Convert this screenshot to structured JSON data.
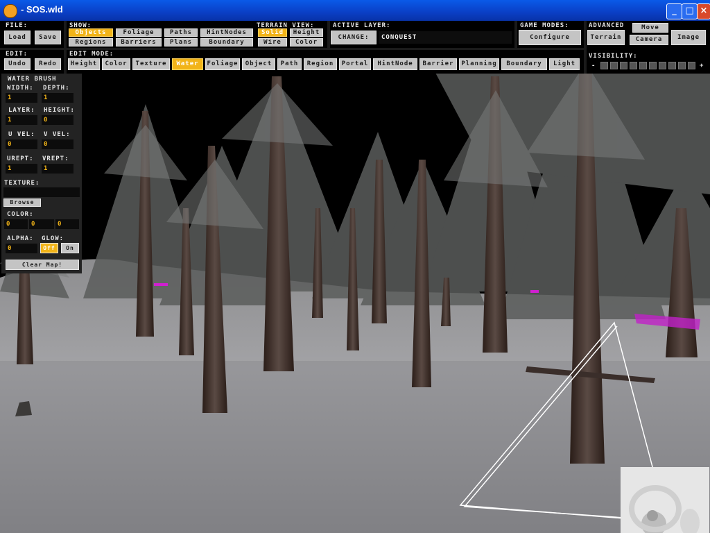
{
  "window": {
    "title": "- SOS.wld"
  },
  "file": {
    "label": "FILE:",
    "load": "Load",
    "save": "Save"
  },
  "show": {
    "label": "SHOW:",
    "row1": [
      "Objects",
      "Foliage",
      "Paths",
      "HintNodes"
    ],
    "row2": [
      "Regions",
      "Barriers",
      "Plans",
      "Boundary"
    ],
    "selected": "Objects"
  },
  "terrain_view": {
    "label": "TERRAIN VIEW:",
    "row1": [
      "Solid",
      "Height"
    ],
    "row2": [
      "Wire",
      "Color"
    ],
    "selected": "Solid"
  },
  "active_layer": {
    "label": "ACTIVE LAYER:",
    "change": "CHANGE:",
    "value": "CONQUEST"
  },
  "game_modes": {
    "label": "GAME MODES:",
    "configure": "Configure"
  },
  "advanced": {
    "label": "ADVANCED",
    "terrain": "Terrain",
    "move": "Move",
    "camera": "Camera",
    "image": "Image"
  },
  "edit": {
    "label": "EDIT:",
    "undo": "Undo",
    "redo": "Redo"
  },
  "edit_mode": {
    "label": "EDIT MODE:",
    "items": [
      "Height",
      "Color",
      "Texture",
      "Water",
      "Foliage",
      "Object",
      "Path",
      "Region",
      "Portal",
      "HintNode",
      "Barrier",
      "Planning",
      "Boundary",
      "Light"
    ],
    "selected": "Water"
  },
  "visibility": {
    "label": "VISIBILITY:",
    "minus": "-",
    "plus": "+",
    "boxes": 10
  },
  "brush": {
    "title": "WATER BRUSH",
    "width_label": "WIDTH:",
    "width": "1",
    "depth_label": "DEPTH:",
    "depth": "1",
    "layer_label": "LAYER:",
    "layer": "1",
    "height_label": "HEIGHT:",
    "height": "0",
    "uvel_label": "U VEL:",
    "uvel": "0",
    "vvel_label": "V VEL:",
    "vvel": "0",
    "urept_label": "UREPT:",
    "urept": "1",
    "vrept_label": "VREPT:",
    "vrept": "1",
    "texture_label": "TEXTURE:",
    "texture": "",
    "browse": "Browse",
    "color_label": "COLOR:",
    "color": [
      "0",
      "0",
      "0"
    ],
    "alpha_label": "ALPHA:",
    "alpha": "0",
    "glow_label": "GLOW:",
    "glow_off": "Off",
    "glow_on": "On",
    "glow_selected": "Off",
    "clear": "Clear Map!"
  },
  "colors": {
    "accent": "#f2b418",
    "button": "#c4c4c4",
    "panel": "#232323",
    "titlebar": "#0a4ad8"
  }
}
